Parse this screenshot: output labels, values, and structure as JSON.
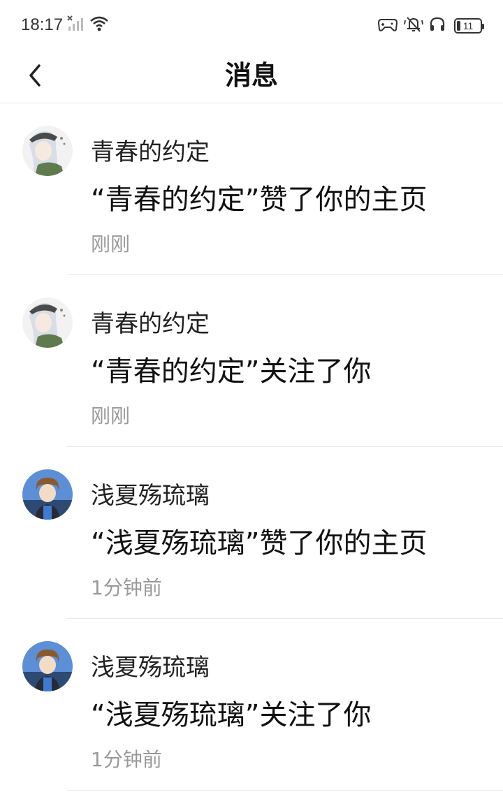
{
  "status_bar": {
    "time": "18:17",
    "battery": "11"
  },
  "header": {
    "title": "消息"
  },
  "messages": [
    {
      "name": "青春的约定",
      "text": "“青春的约定”赞了你的主页",
      "time": "刚刚",
      "avatar": "girl-avatar"
    },
    {
      "name": "青春的约定",
      "text": "“青春的约定”关注了你",
      "time": "刚刚",
      "avatar": "girl-avatar"
    },
    {
      "name": "浅夏殇琉璃",
      "text": "“浅夏殇琉璃”赞了你的主页",
      "time": "1分钟前",
      "avatar": "boy-avatar"
    },
    {
      "name": "浅夏殇琉璃",
      "text": "“浅夏殇琉璃”关注了你",
      "time": "1分钟前",
      "avatar": "boy-avatar"
    }
  ],
  "colors": {
    "title": "#111111",
    "time_text": "#999999",
    "divider": "#e8e8e8"
  }
}
